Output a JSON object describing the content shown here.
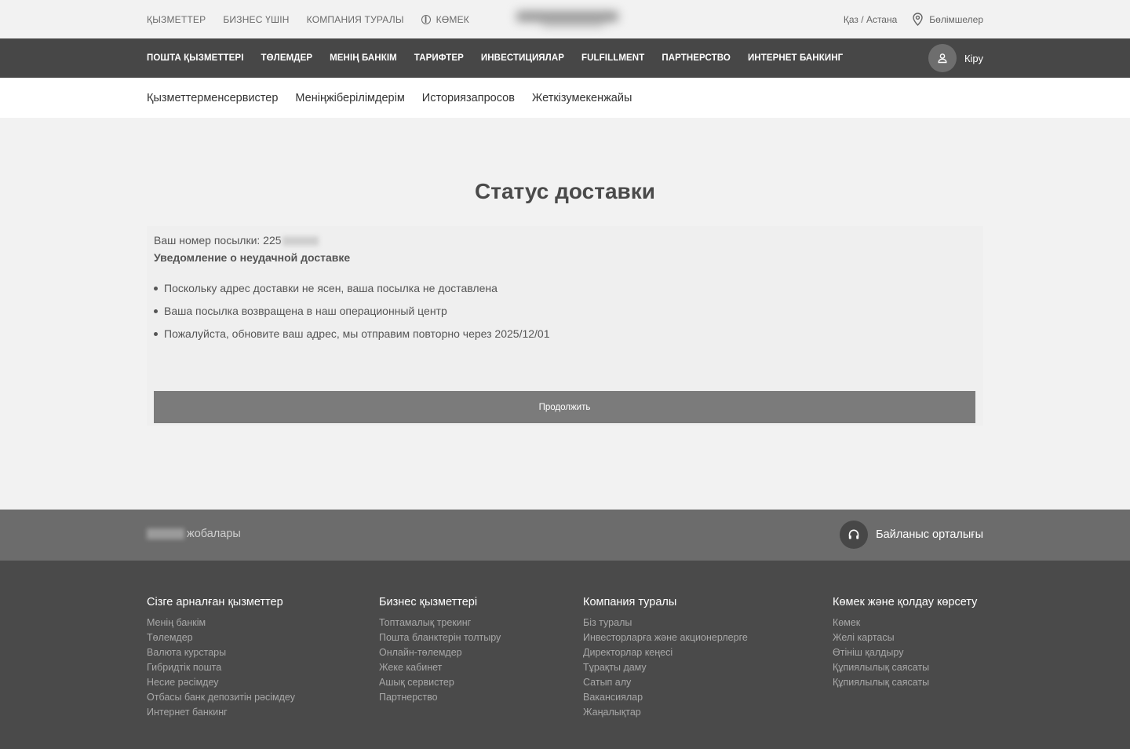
{
  "topbar": {
    "links": [
      "ҚЫЗМЕТТЕР",
      "БИЗНЕС ҮШІН",
      "КОМПАНИЯ ТУРАЛЫ"
    ],
    "help_label": "КӨМЕК",
    "lang_city": "Қаз / Астана",
    "branches_label": "Бөлімшелер"
  },
  "mainnav": {
    "items": [
      "ПОШТА ҚЫЗМЕТТЕРІ",
      "ТӨЛЕМДЕР",
      "МЕНІҢ БАНКІМ",
      "ТАРИФТЕР",
      "ИНВЕСТИЦИЯЛАР",
      "FULFILLMENT",
      "ПАРТНЕРСТВО",
      "ИНТЕРНЕТ БАНКИНГ"
    ],
    "login_label": "Кіру"
  },
  "subnav": {
    "items": [
      "Қызметтерменсервистер",
      "Менiңжiберiлiмдерiм",
      "Историязапросов",
      "Жеткізумекенжайы"
    ]
  },
  "main": {
    "title": "Статус доставки",
    "parcel_label": "Ваш номер посылки: 225",
    "notice": "Уведомление о неудачной доставке",
    "bullets": [
      "Поскольку адрес доставки не ясен, ваша посылка не доставлена",
      "Ваша посылка возвращена в наш операционный центр",
      "Пожалуйста, обновите ваш адрес, мы отправим повторно через 2025/12/01"
    ],
    "continue_label": "Продолжить"
  },
  "strip": {
    "projects_label": "жобалары",
    "contact_label": "Байланыс орталығы"
  },
  "footer": {
    "columns": [
      {
        "title": "Сізге арналған қызметтер",
        "links": [
          "Менің банкім",
          "Төлемдер",
          "Валюта курстары",
          "Гибридтік пошта",
          "Несие рәсімдеу",
          "Отбасы банк депозитін рәсімдеу",
          "Интернет банкинг"
        ]
      },
      {
        "title": "Бизнес қызметтері",
        "links": [
          "Топтамалық трекинг",
          "Пошта бланктерін толтыру",
          "Онлайн-төлемдер",
          "Жеке кабинет",
          "Ашық сервистер",
          "Партнерство"
        ]
      },
      {
        "title": "Компания туралы",
        "links": [
          "Біз туралы",
          "Инвесторларға және акционерлерге",
          "Директорлар кеңесі",
          "Тұрақты даму",
          "Сатып алу",
          "Вакансиялар",
          "Жаңалықтар"
        ]
      },
      {
        "title": "Көмек және қолдау көрсету",
        "links": [
          "Көмек",
          "Желі картасы",
          "Өтініш қалдыру",
          "Құпиялылық саясаты",
          "Құпиялылық саясаты"
        ]
      }
    ]
  }
}
